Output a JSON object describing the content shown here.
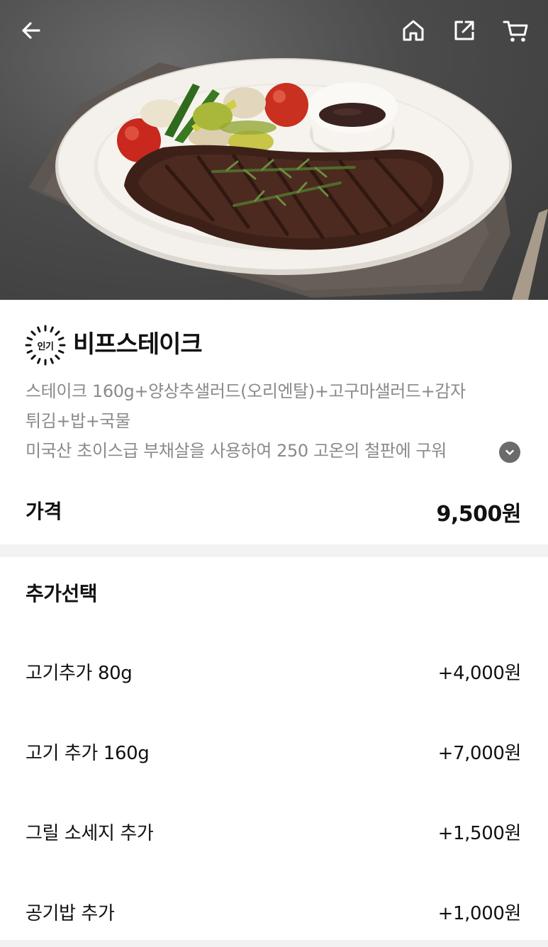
{
  "header": {
    "back_icon": "arrow-left-icon",
    "home_icon": "home-icon",
    "share_icon": "share-icon",
    "cart_icon": "cart-icon"
  },
  "product": {
    "badge": "인기",
    "name": "비프스테이크",
    "description_lines": [
      "스테이크 160g+양상추샐러드(오리엔탈)+고구마샐러드+감자",
      "튀김+밥+국물",
      "미국산 초이스급 부채살을 사용하여 250 고온의 철판에 구워"
    ],
    "price_label": "가격",
    "price_value": "9,500원"
  },
  "options": {
    "title": "추가선택",
    "items": [
      {
        "name": "고기추가 80g",
        "price": "+4,000원"
      },
      {
        "name": "고기 추가 160g",
        "price": "+7,000원"
      },
      {
        "name": "그릴 소세지 추가",
        "price": "+1,500원"
      },
      {
        "name": "공기밥 추가",
        "price": "+1,000원"
      }
    ]
  },
  "colors": {
    "text_primary": "#111111",
    "text_secondary": "#8a8a8a",
    "section_gap": "#f2f2f2",
    "expand_button": "#6b6b6b"
  }
}
